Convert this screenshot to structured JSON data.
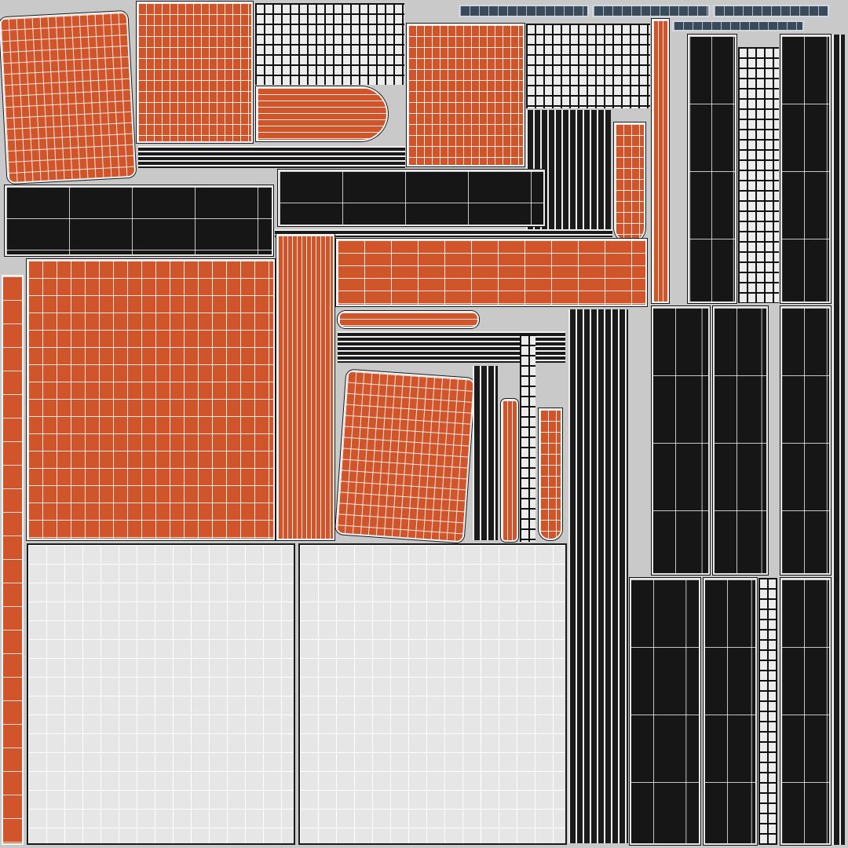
{
  "texture": {
    "colors": {
      "orange": "#d0552a",
      "dark": "#161616",
      "light": "#e6e6e6",
      "background": "#c9c9c9",
      "wire": "#f4f4f4"
    }
  }
}
